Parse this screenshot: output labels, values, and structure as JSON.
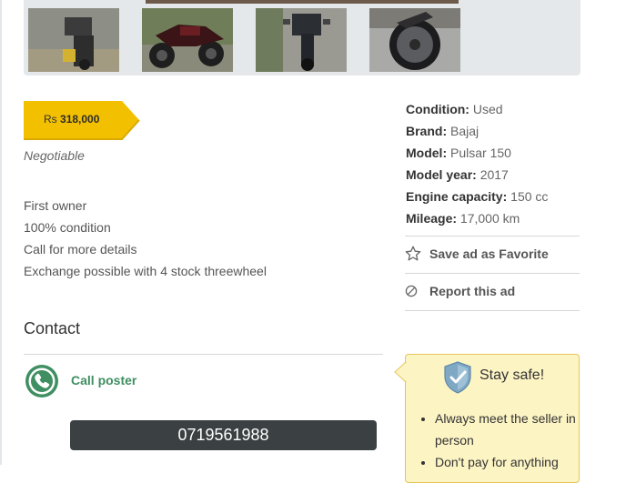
{
  "price": {
    "currency": "Rs",
    "amount": "318,000",
    "note": "Negotiable"
  },
  "description": [
    "First owner",
    "100% condition",
    "Call for more details",
    "Exchange possible with 4 stock threewheel"
  ],
  "contact": {
    "title": "Contact",
    "call_label": "Call poster",
    "phone": "0719561988"
  },
  "details": [
    {
      "label": "Condition:",
      "value": "Used"
    },
    {
      "label": "Brand:",
      "value": "Bajaj"
    },
    {
      "label": "Model:",
      "value": "Pulsar 150"
    },
    {
      "label": "Model year:",
      "value": "2017"
    },
    {
      "label": "Engine capacity:",
      "value": "150 cc"
    },
    {
      "label": "Mileage:",
      "value": "17,000 km"
    }
  ],
  "actions": {
    "favorite": "Save ad as Favorite",
    "report": "Report this ad"
  },
  "safety": {
    "title": "Stay safe!",
    "tips": [
      "Always meet the seller in person",
      "Don't pay for anything"
    ]
  },
  "icons": [
    "star-icon",
    "report-icon",
    "phone-icon",
    "shield-icon"
  ],
  "colors": {
    "price_tag": "#f3c000",
    "call_green": "#3f8f62",
    "phone_button": "#3b4143",
    "safety_bg": "#fdf4c4"
  }
}
